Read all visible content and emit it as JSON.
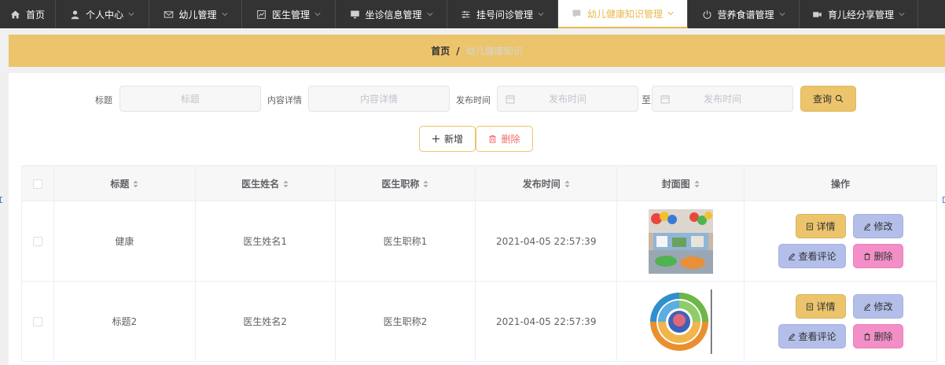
{
  "nav": {
    "items": [
      {
        "label": "首页",
        "icon": "home-icon",
        "dropdown": false
      },
      {
        "label": "个人中心",
        "icon": "user-icon",
        "dropdown": true
      },
      {
        "label": "幼儿管理",
        "icon": "mail-icon",
        "dropdown": true
      },
      {
        "label": "医生管理",
        "icon": "chart-icon",
        "dropdown": true
      },
      {
        "label": "坐诊信息管理",
        "icon": "monitor-icon",
        "dropdown": true
      },
      {
        "label": "挂号问诊管理",
        "icon": "sliders-icon",
        "dropdown": true
      },
      {
        "label": "幼儿健康知识管理",
        "icon": "chat-icon",
        "dropdown": true,
        "active": true
      },
      {
        "label": "营养食谱管理",
        "icon": "power-icon",
        "dropdown": true
      },
      {
        "label": "育儿经分享管理",
        "icon": "video-icon",
        "dropdown": true
      }
    ]
  },
  "breadcrumb": {
    "home": "首页",
    "separator": "/",
    "current": "幼儿健康知识"
  },
  "search": {
    "title_label": "标题",
    "title_placeholder": "标题",
    "content_label": "内容详情",
    "content_placeholder": "内容详情",
    "time_label": "发布时间",
    "time_start_placeholder": "发布时间",
    "range_sep": "至",
    "time_end_placeholder": "发布时间",
    "query_label": "查询"
  },
  "actions": {
    "add_label": "新增",
    "delete_label": "删除"
  },
  "table": {
    "headers": [
      "标题",
      "医生姓名",
      "医生职称",
      "发布时间",
      "封面图",
      "操作"
    ],
    "rows": [
      {
        "title": "健康",
        "doctor": "医生姓名1",
        "rank": "医生职称1",
        "time": "2021-04-05 22:57:39"
      },
      {
        "title": "标题2",
        "doctor": "医生姓名2",
        "rank": "医生职称2",
        "time": "2021-04-05 22:57:39"
      }
    ],
    "row_buttons": {
      "detail": "详情",
      "edit": "修改",
      "comment": "查看评论",
      "delete": "删除"
    }
  },
  "colors": {
    "accent": "#ebc46c",
    "nav_bg": "#333333",
    "edit_btn": "#b3bfe9",
    "delete_btn": "#f38fc7",
    "danger_text": "#f56c6c"
  }
}
